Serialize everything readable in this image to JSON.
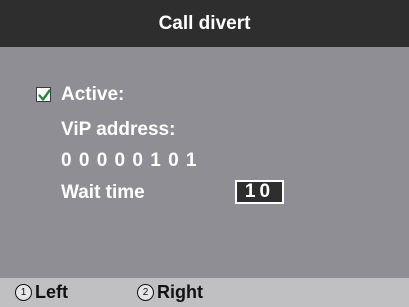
{
  "header": {
    "title": "Call divert"
  },
  "form": {
    "active_label": "Active:",
    "active_checked": true,
    "vip_address_label": "ViP address:",
    "vip_address_value": "0 0 0 0 0 1 0 1",
    "wait_time_label": "Wait time",
    "wait_time_value": "10"
  },
  "softkeys": [
    {
      "number": "1",
      "label": "Left"
    },
    {
      "number": "2",
      "label": "Right"
    }
  ],
  "colors": {
    "title_bar": "#2e2e2e",
    "content_bg": "#8e8e94",
    "footer_bg": "#c0c0c3",
    "text": "#ffffff",
    "check_mark": "#1f8a3a"
  }
}
